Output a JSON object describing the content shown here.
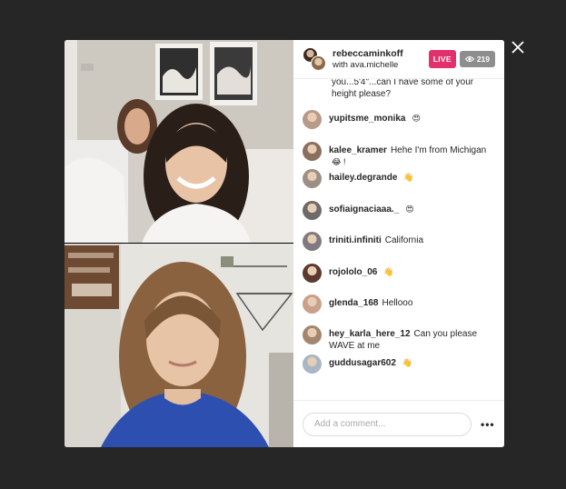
{
  "colors": {
    "backdrop": "#262626",
    "live": "#e1306c",
    "viewer_badge": "#8e8e8e",
    "text": "#262626",
    "placeholder": "#a8a8a8"
  },
  "header": {
    "host_username": "rebeccaminkoff",
    "with_label": "with ava.michelle",
    "live_label": "LIVE",
    "viewer_icon": "eye-icon",
    "viewer_count": "219"
  },
  "partial_comment": {
    "text": "you...5'4\"...can I have some of your height please?"
  },
  "comments": [
    {
      "user": "yupitsme_monika",
      "text": "",
      "emoji": "😍",
      "avatar_color": "#b79a8a"
    },
    {
      "user": "kalee_kramer",
      "text": "Hehe I'm from Michigan",
      "emoji": "😂 !",
      "avatar_color": "#8a6f5f"
    },
    {
      "user": "hailey.degrande",
      "text": "",
      "emoji": "👋",
      "avatar_color": "#9c8f86"
    },
    {
      "user": "sofiaignaciaaa._",
      "text": "",
      "emoji": "😍",
      "avatar_color": "#6d6a6a"
    },
    {
      "user": "triniti.infiniti",
      "text": "California",
      "emoji": "",
      "avatar_color": "#7f7a80"
    },
    {
      "user": "rojololo_06",
      "text": "",
      "emoji": "👋",
      "avatar_color": "#5b3a2e"
    },
    {
      "user": "glenda_168",
      "text": "Hellooo",
      "emoji": "",
      "avatar_color": "#c9a08c"
    },
    {
      "user": "hey_karla_here_12",
      "text": "Can you please WAVE at me",
      "emoji": "",
      "avatar_color": "#a4866f"
    },
    {
      "user": "guddusagar602",
      "text": "",
      "emoji": "👋",
      "avatar_color": "#a9b6c4"
    }
  ],
  "footer": {
    "input_placeholder": "Add a comment...",
    "more_label": "•••"
  },
  "icons": {
    "close": "close-icon",
    "more": "more-options-icon"
  }
}
